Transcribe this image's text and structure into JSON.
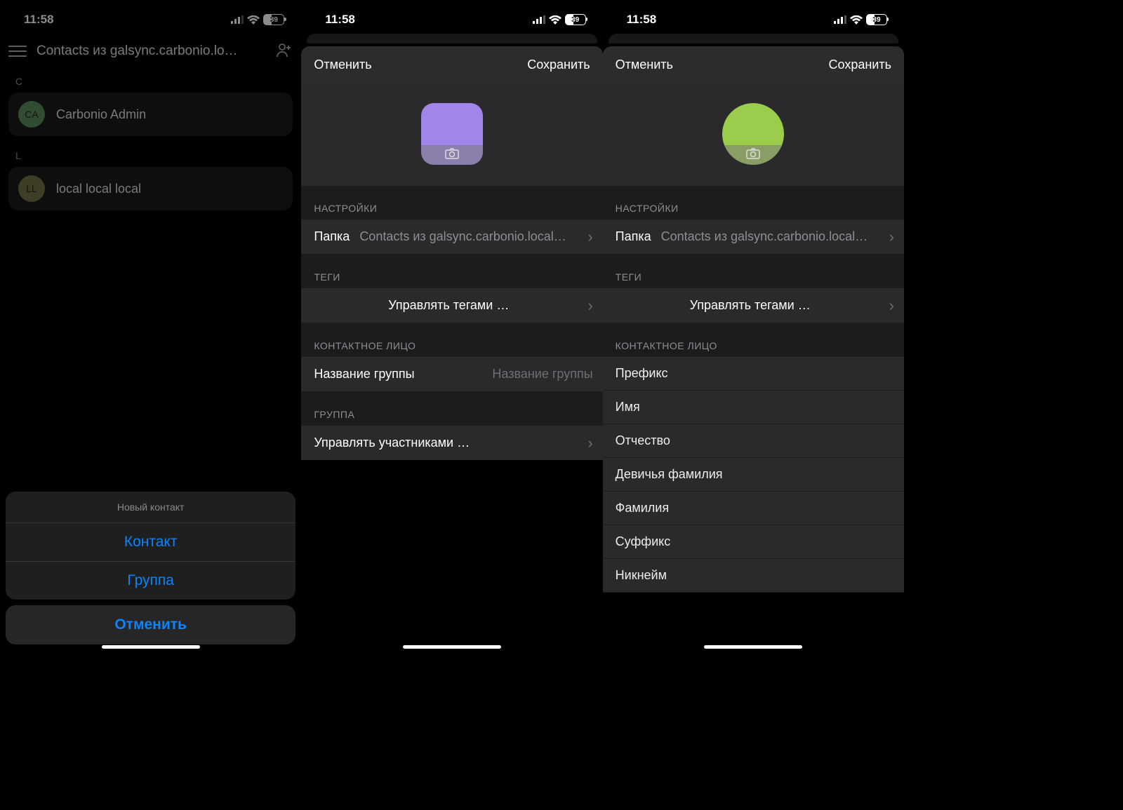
{
  "status": {
    "time": "11:58",
    "battery": "39"
  },
  "screen1": {
    "title": "Contacts из galsync.carbonio.lo…",
    "sections": [
      {
        "letter": "C",
        "items": [
          {
            "initials": "CA",
            "name": "Carbonio Admin",
            "avatar": "green"
          }
        ]
      },
      {
        "letter": "L",
        "items": [
          {
            "initials": "LL",
            "name": "local local local",
            "avatar": "olive"
          }
        ]
      }
    ],
    "sheet": {
      "title": "Новый контакт",
      "option1": "Контакт",
      "option2": "Группа",
      "cancel": "Отменить"
    }
  },
  "screen2": {
    "cancel": "Отменить",
    "save": "Сохранить",
    "sect_settings": "НАСТРОЙКИ",
    "folder_label": "Папка",
    "folder_value": "Contacts из galsync.carbonio.local…",
    "sect_tags": "ТЕГИ",
    "manage_tags": "Управлять тегами …",
    "sect_contact": "КОНТАКТНОЕ ЛИЦО",
    "groupname_label": "Название группы",
    "groupname_ph": "Название группы",
    "sect_group": "ГРУППА",
    "manage_members": "Управлять участниками …"
  },
  "screen3": {
    "cancel": "Отменить",
    "save": "Сохранить",
    "sect_settings": "НАСТРОЙКИ",
    "folder_label": "Папка",
    "folder_value": "Contacts из galsync.carbonio.local…",
    "sect_tags": "ТЕГИ",
    "manage_tags": "Управлять тегами …",
    "sect_contact": "КОНТАКТНОЕ ЛИЦО",
    "fields": {
      "prefix": "Префикс",
      "first": "Имя",
      "middle": "Отчество",
      "maiden": "Девичья фамилия",
      "last": "Фамилия",
      "suffix": "Суффикс",
      "nick": "Никнейм"
    }
  }
}
